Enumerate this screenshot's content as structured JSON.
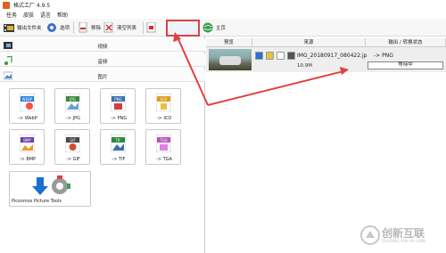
{
  "window": {
    "title": "格式工厂 4.9.5"
  },
  "menu": [
    "任务",
    "皮肤",
    "语言",
    "帮助"
  ],
  "toolbar": {
    "output_folder": "输出文件夹",
    "options": "选项",
    "remove": "移除",
    "clear_list": "清空列表",
    "start": "开始",
    "home": "主页"
  },
  "categories": {
    "video": "视频",
    "audio": "音频",
    "image": "图片"
  },
  "formats": [
    {
      "label": "-> WebP",
      "badge": "WEBP",
      "color": "#2a7de1"
    },
    {
      "label": "-> JPG",
      "badge": "JPG",
      "color": "#3a8a3a"
    },
    {
      "label": "-> PNG",
      "badge": "PNG",
      "color": "#3a6fb0"
    },
    {
      "label": "-> ICO",
      "badge": "ICO",
      "color": "#d9a020"
    },
    {
      "label": "-> BMP",
      "badge": "BMP",
      "color": "#6b3fb0"
    },
    {
      "label": "-> GIF",
      "badge": "GIF",
      "color": "#4a4a4a"
    },
    {
      "label": "-> TIF",
      "badge": "TIF",
      "color": "#2a8a3a"
    },
    {
      "label": "-> TGA",
      "badge": "TGA",
      "color": "#c050c0"
    }
  ],
  "tools": {
    "picosmos": "Picosmos Picture Tools"
  },
  "task_table": {
    "headers": {
      "preview": "预览",
      "source": "来源",
      "output": "输出 / 转换状态"
    },
    "row": {
      "filename": "IMG_20180917_080422.jp",
      "size": "10.9M",
      "target": "-> PNG",
      "status": "等待中"
    }
  },
  "watermark": {
    "title": "创新互联",
    "subtitle": "CHUANG XIN HU LIAN"
  },
  "colors": {
    "annotation_red": "#e04040",
    "accent_blue": "#2a7de1"
  }
}
